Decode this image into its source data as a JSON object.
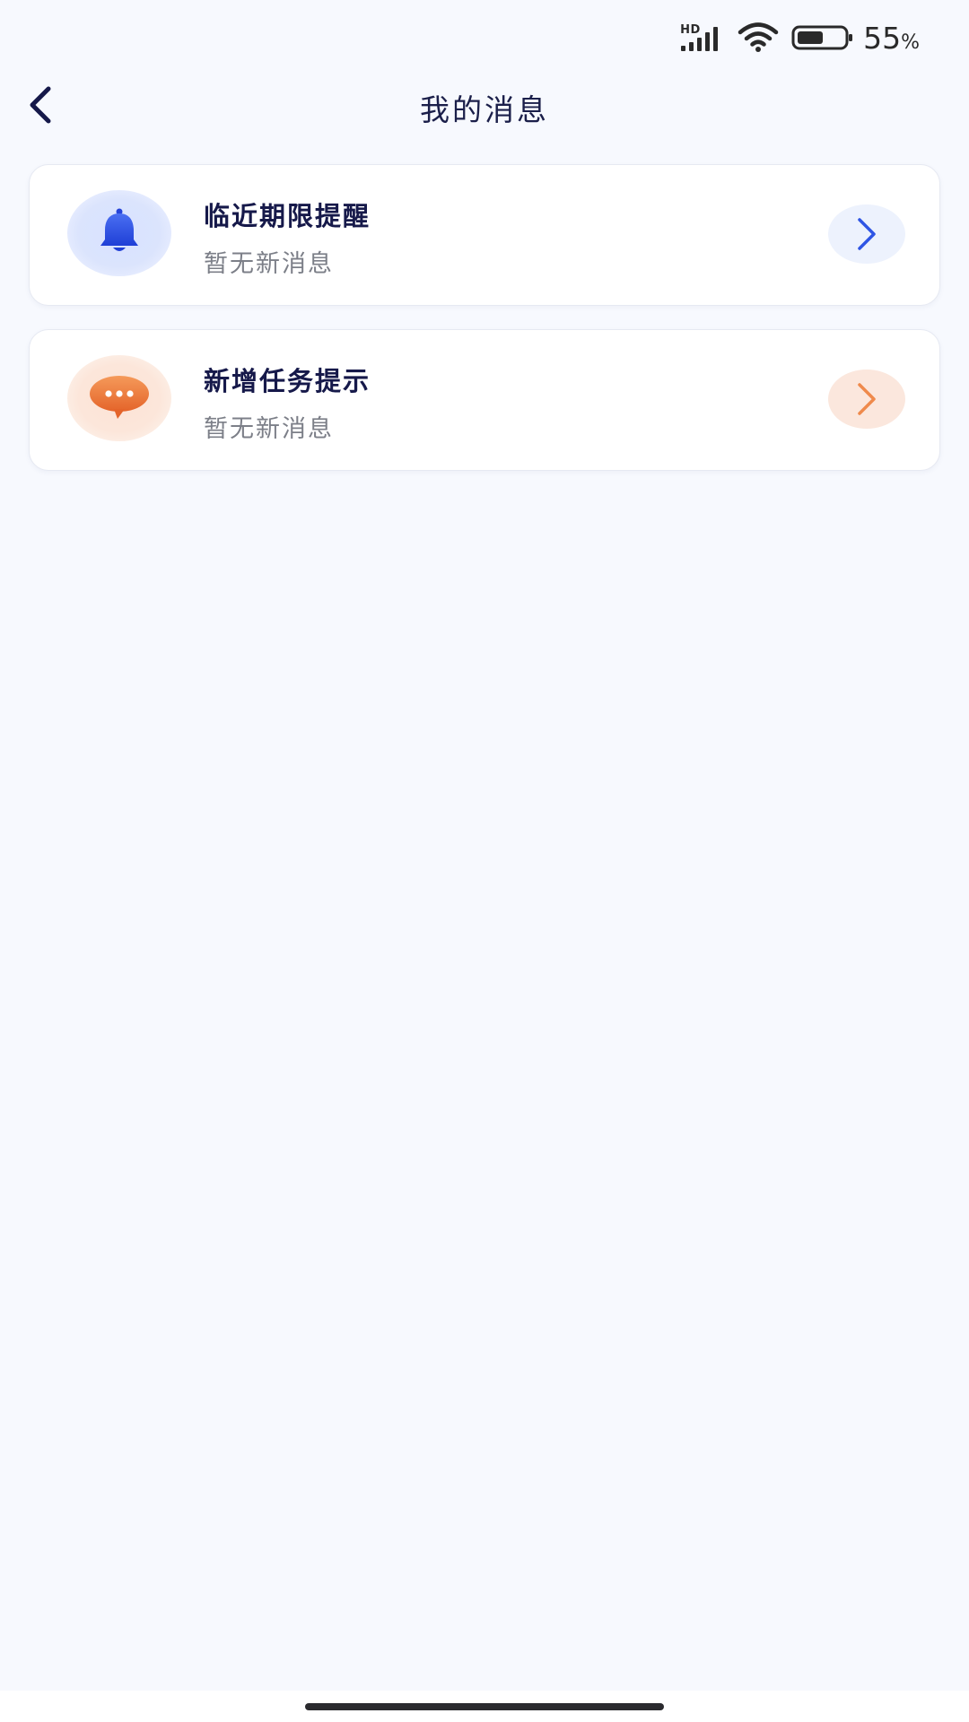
{
  "status_bar": {
    "network_label": "HD",
    "battery_percent": "55",
    "battery_percent_sign": "%",
    "battery_level": 0.55,
    "icons": [
      "signal-icon",
      "wifi-icon",
      "battery-icon"
    ]
  },
  "header": {
    "title": "我的消息",
    "back_icon": "chevron-left-icon"
  },
  "messages": [
    {
      "title": "临近期限提醒",
      "subtitle": "暂无新消息",
      "icon": "bell-icon",
      "accent": "#2f55e4"
    },
    {
      "title": "新增任务提示",
      "subtitle": "暂无新消息",
      "icon": "chat-bubble-icon",
      "accent": "#ef7a3a"
    }
  ],
  "colors": {
    "background": "#f7f9fe",
    "title_text": "#16194a",
    "subtitle_text": "#7c7f88",
    "blue_accent": "#2f55e4",
    "orange_accent": "#ef7a3a"
  }
}
